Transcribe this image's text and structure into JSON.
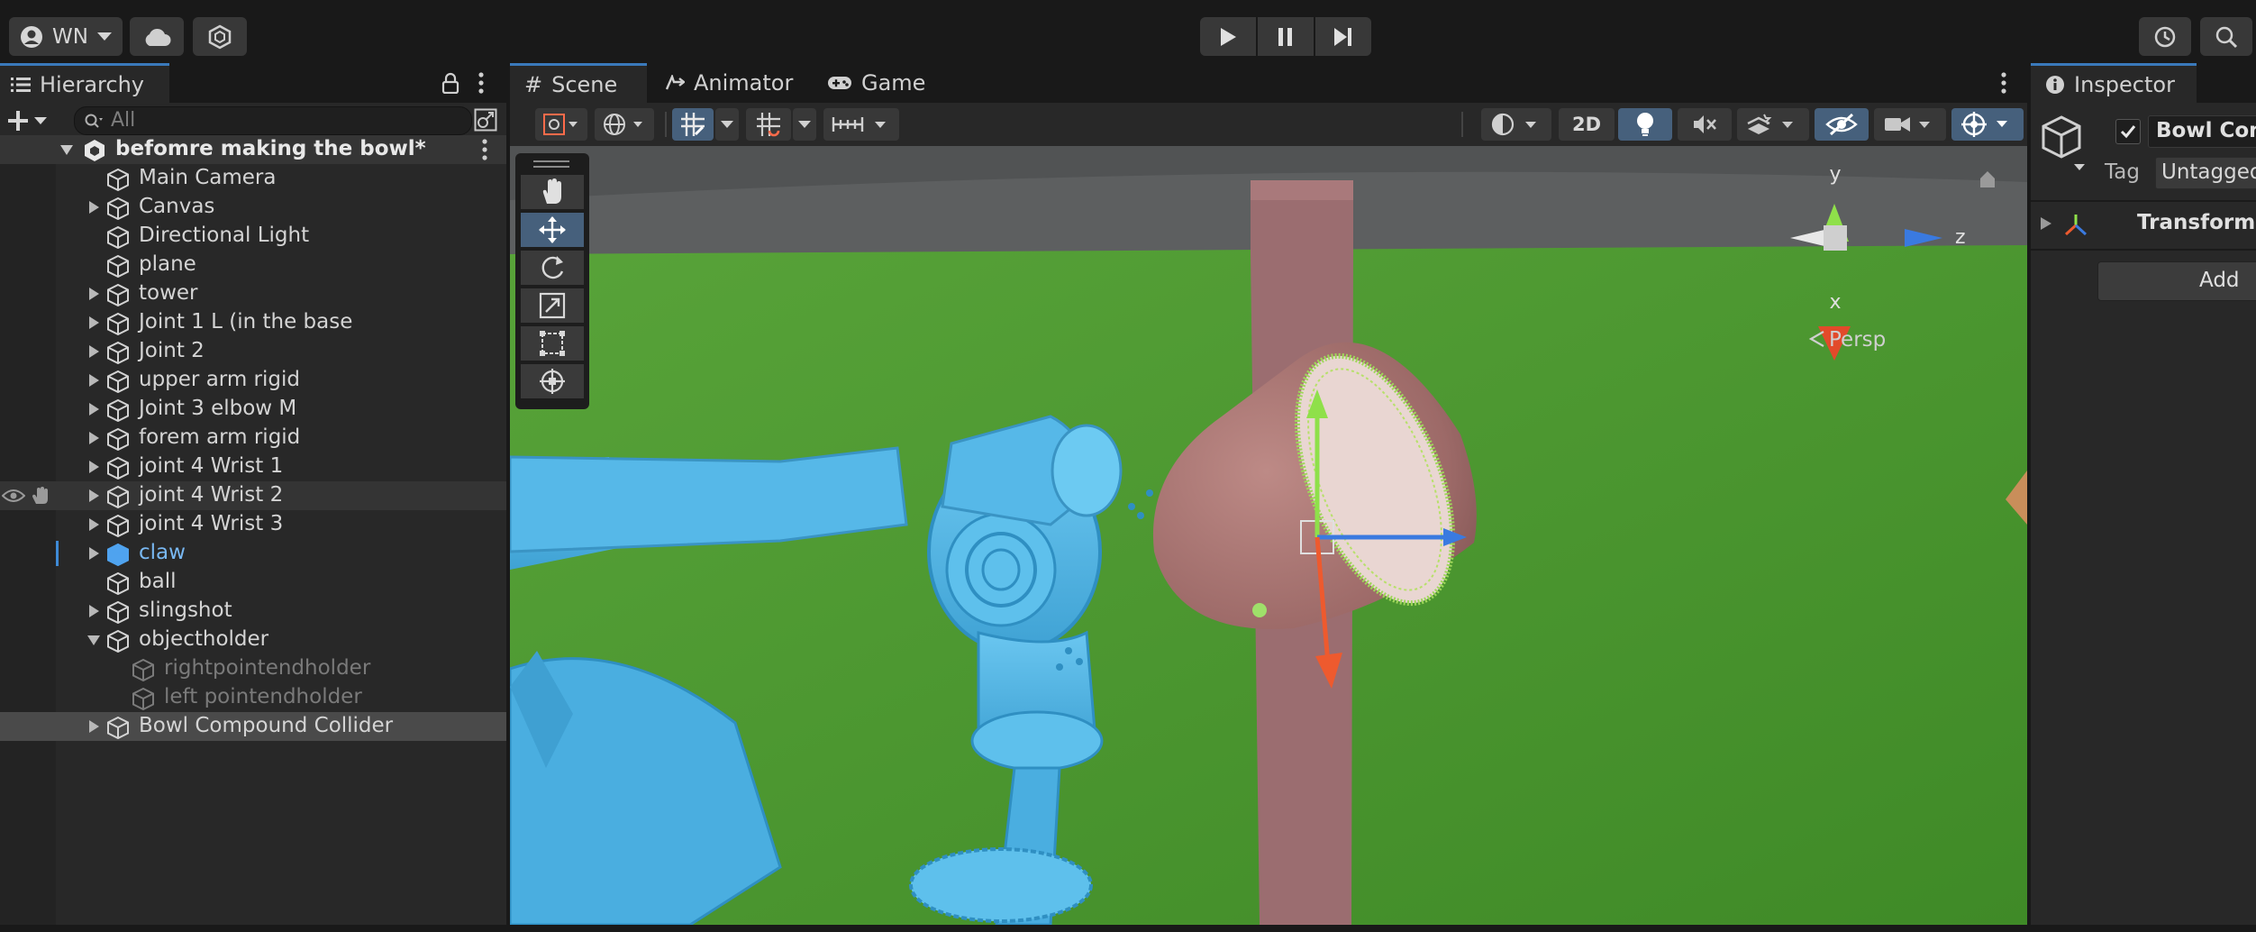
{
  "topbar": {
    "account_label": "WN"
  },
  "hierarchy": {
    "tab_label": "Hierarchy",
    "search_placeholder": "All",
    "scene_name": "befomre making the bowl*",
    "items": [
      {
        "label": "Main Camera",
        "depth": 1,
        "expandable": false,
        "state": "normal"
      },
      {
        "label": "Canvas",
        "depth": 1,
        "expandable": true,
        "state": "normal"
      },
      {
        "label": "Directional Light",
        "depth": 1,
        "expandable": false,
        "state": "normal"
      },
      {
        "label": "plane",
        "depth": 1,
        "expandable": false,
        "state": "normal"
      },
      {
        "label": "tower",
        "depth": 1,
        "expandable": true,
        "state": "normal"
      },
      {
        "label": "Joint 1 L (in the base",
        "depth": 1,
        "expandable": true,
        "state": "normal"
      },
      {
        "label": "Joint 2",
        "depth": 1,
        "expandable": true,
        "state": "normal"
      },
      {
        "label": "upper arm rigid",
        "depth": 1,
        "expandable": true,
        "state": "normal"
      },
      {
        "label": "Joint 3 elbow M",
        "depth": 1,
        "expandable": true,
        "state": "normal"
      },
      {
        "label": "forem arm rigid",
        "depth": 1,
        "expandable": true,
        "state": "normal"
      },
      {
        "label": "joint 4 Wrist 1",
        "depth": 1,
        "expandable": true,
        "state": "normal"
      },
      {
        "label": "joint 4 Wrist 2",
        "depth": 1,
        "expandable": true,
        "state": "hover"
      },
      {
        "label": "joint 4 Wrist 3",
        "depth": 1,
        "expandable": true,
        "state": "normal"
      },
      {
        "label": "claw",
        "depth": 1,
        "expandable": true,
        "state": "prefab"
      },
      {
        "label": "ball",
        "depth": 1,
        "expandable": false,
        "state": "normal"
      },
      {
        "label": "slingshot",
        "depth": 1,
        "expandable": true,
        "state": "normal"
      },
      {
        "label": "objectholder",
        "depth": 1,
        "expandable": true,
        "expanded": true,
        "state": "normal"
      },
      {
        "label": "rightpointendholder",
        "depth": 2,
        "expandable": false,
        "state": "disabled"
      },
      {
        "label": "left pointendholder",
        "depth": 2,
        "expandable": false,
        "state": "disabled"
      },
      {
        "label": "Bowl Compound Collider",
        "depth": 1,
        "expandable": true,
        "state": "selected"
      }
    ]
  },
  "scene": {
    "tabs": [
      {
        "label": "Scene",
        "icon": "grid-icon"
      },
      {
        "label": "Animator",
        "icon": "animator-icon"
      },
      {
        "label": "Game",
        "icon": "gamepad-icon"
      }
    ],
    "toolbar": {
      "mode_2d_label": "2D"
    },
    "gizmo": {
      "y_label": "y",
      "z_label": "z",
      "x_label": "x",
      "projection_label": "Persp"
    },
    "colors": {
      "ground": "#4e9a31",
      "arm": "#52b6e6",
      "bowl": "#a87472",
      "tower": "#9a6b6e"
    }
  },
  "inspector": {
    "tab_label": "Inspector",
    "object_name": "Bowl Com",
    "tag_label": "Tag",
    "tag_value": "Untagged",
    "component_label": "Transform",
    "add_button_label": "Add"
  }
}
